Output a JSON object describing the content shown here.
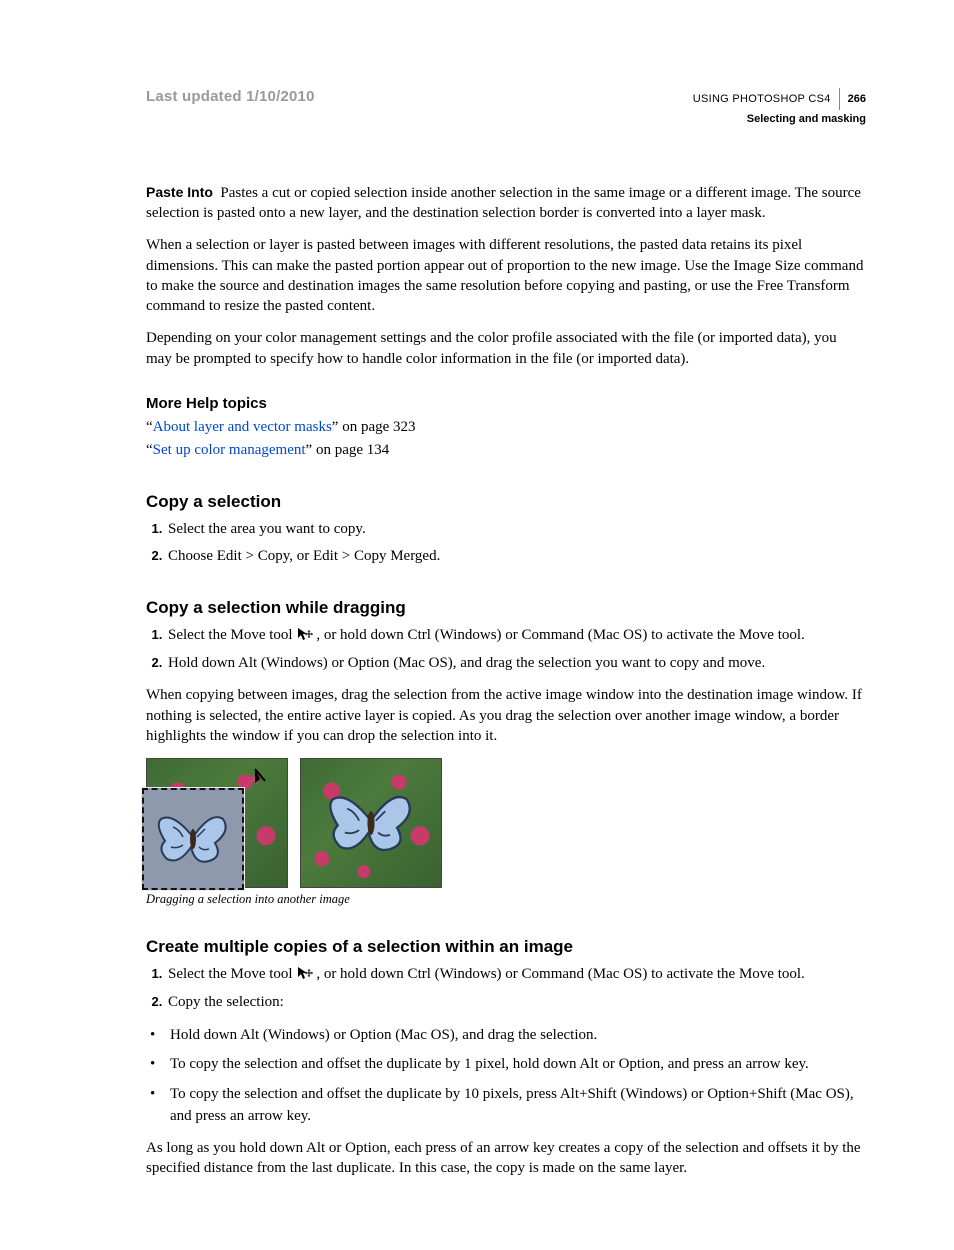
{
  "header": {
    "last_updated": "Last updated 1/10/2010",
    "book": "USING PHOTOSHOP CS4",
    "page_number": "266",
    "chapter": "Selecting and masking"
  },
  "para_paste_into_term": "Paste Into",
  "para_paste_into": "Pastes a cut or copied selection inside another selection in the same image or a different image. The source selection is pasted onto a new layer, and the destination selection border is converted into a layer mask.",
  "para_resolution": "When a selection or layer is pasted between images with different resolutions, the pasted data retains its pixel dimensions. This can make the pasted portion appear out of proportion to the new image. Use the Image Size command to make the source and destination images the same resolution before copying and pasting, or use the Free Transform command to resize the pasted content.",
  "para_color_mgmt": "Depending on your color management settings and the color profile associated with the file (or imported data), you may be prompted to specify how to handle color information in the file (or imported data).",
  "more_help_heading": "More Help topics",
  "help1_open": "“",
  "help1_link": "About layer and vector masks",
  "help1_rest": "” on page 323",
  "help2_open": "“",
  "help2_link": "Set up color management",
  "help2_rest": "” on page 134",
  "sec1_title": "Copy a selection",
  "sec1_step1": "Select the area you want to copy.",
  "sec1_step2": "Choose Edit > Copy, or Edit > Copy Merged.",
  "sec2_title": "Copy a selection while dragging",
  "sec2_step1_a": "Select the Move tool ",
  "sec2_step1_b": ", or hold down Ctrl (Windows) or Command (Mac OS) to activate the Move tool.",
  "sec2_step2": "Hold down Alt (Windows) or Option (Mac OS), and drag the selection you want to copy and move.",
  "sec2_para": "When copying between images, drag the selection from the active image window into the destination image window. If nothing is selected, the entire active layer is copied. As you drag the selection over another image window, a border highlights the window if you can drop the selection into it.",
  "figure_caption": "Dragging a selection into another image",
  "sec3_title": "Create multiple copies of a selection within an image",
  "sec3_step1_a": "Select the Move tool ",
  "sec3_step1_b": ", or hold down Ctrl (Windows) or Command (Mac OS) to activate the Move tool.",
  "sec3_step2": "Copy the selection:",
  "sec3_b1": "Hold down Alt (Windows) or Option (Mac OS), and drag the selection.",
  "sec3_b2": "To copy the selection and offset the duplicate by 1 pixel, hold down Alt or Option, and press an arrow key.",
  "sec3_b3": "To copy the selection and offset the duplicate by 10 pixels, press Alt+Shift (Windows) or Option+Shift (Mac OS), and press an arrow key.",
  "sec3_para": "As long as you hold down Alt or Option, each press of an arrow key creates a copy of the selection and offsets it by the specified distance from the last duplicate. In this case, the copy is made on the same layer."
}
